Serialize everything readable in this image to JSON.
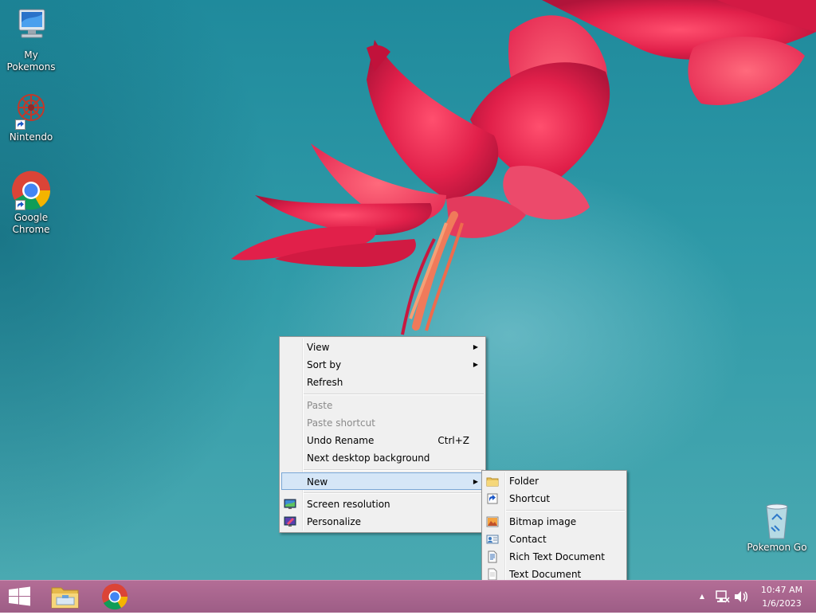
{
  "desktop": {
    "icons": [
      {
        "label": "My\nPokemons"
      },
      {
        "label": "Nintendo"
      },
      {
        "label": "Google\nChrome"
      },
      {
        "label": "Pokemon Go"
      }
    ]
  },
  "context_menu": {
    "items": [
      {
        "label": "View",
        "has_submenu": true
      },
      {
        "label": "Sort by",
        "has_submenu": true
      },
      {
        "label": "Refresh"
      },
      {
        "label": "Paste",
        "disabled": true
      },
      {
        "label": "Paste shortcut",
        "disabled": true
      },
      {
        "label": "Undo Rename",
        "shortcut": "Ctrl+Z"
      },
      {
        "label": "Next desktop background"
      },
      {
        "label": "New",
        "has_submenu": true,
        "highlighted": true
      },
      {
        "label": "Screen resolution",
        "icon": "screen-resolution-icon"
      },
      {
        "label": "Personalize",
        "icon": "personalize-icon"
      }
    ]
  },
  "new_submenu": {
    "items": [
      {
        "label": "Folder",
        "icon": "folder-icon"
      },
      {
        "label": "Shortcut",
        "icon": "shortcut-icon"
      },
      {
        "label": "Bitmap image",
        "icon": "bitmap-image-icon"
      },
      {
        "label": "Contact",
        "icon": "contact-icon"
      },
      {
        "label": "Rich Text Document",
        "icon": "rich-text-document-icon"
      },
      {
        "label": "Text Document",
        "icon": "text-document-icon"
      }
    ]
  },
  "taskbar": {
    "apps": [
      "start-button",
      "file-explorer",
      "google-chrome"
    ],
    "tray": {
      "time": "10:47 AM",
      "date": "1/6/2023"
    }
  },
  "colors": {
    "taskbar": "#a8638e",
    "menu_background": "#f0f0f0",
    "menu_highlight": "#d5e6f7",
    "desktop_background": "#2f9aa8"
  }
}
